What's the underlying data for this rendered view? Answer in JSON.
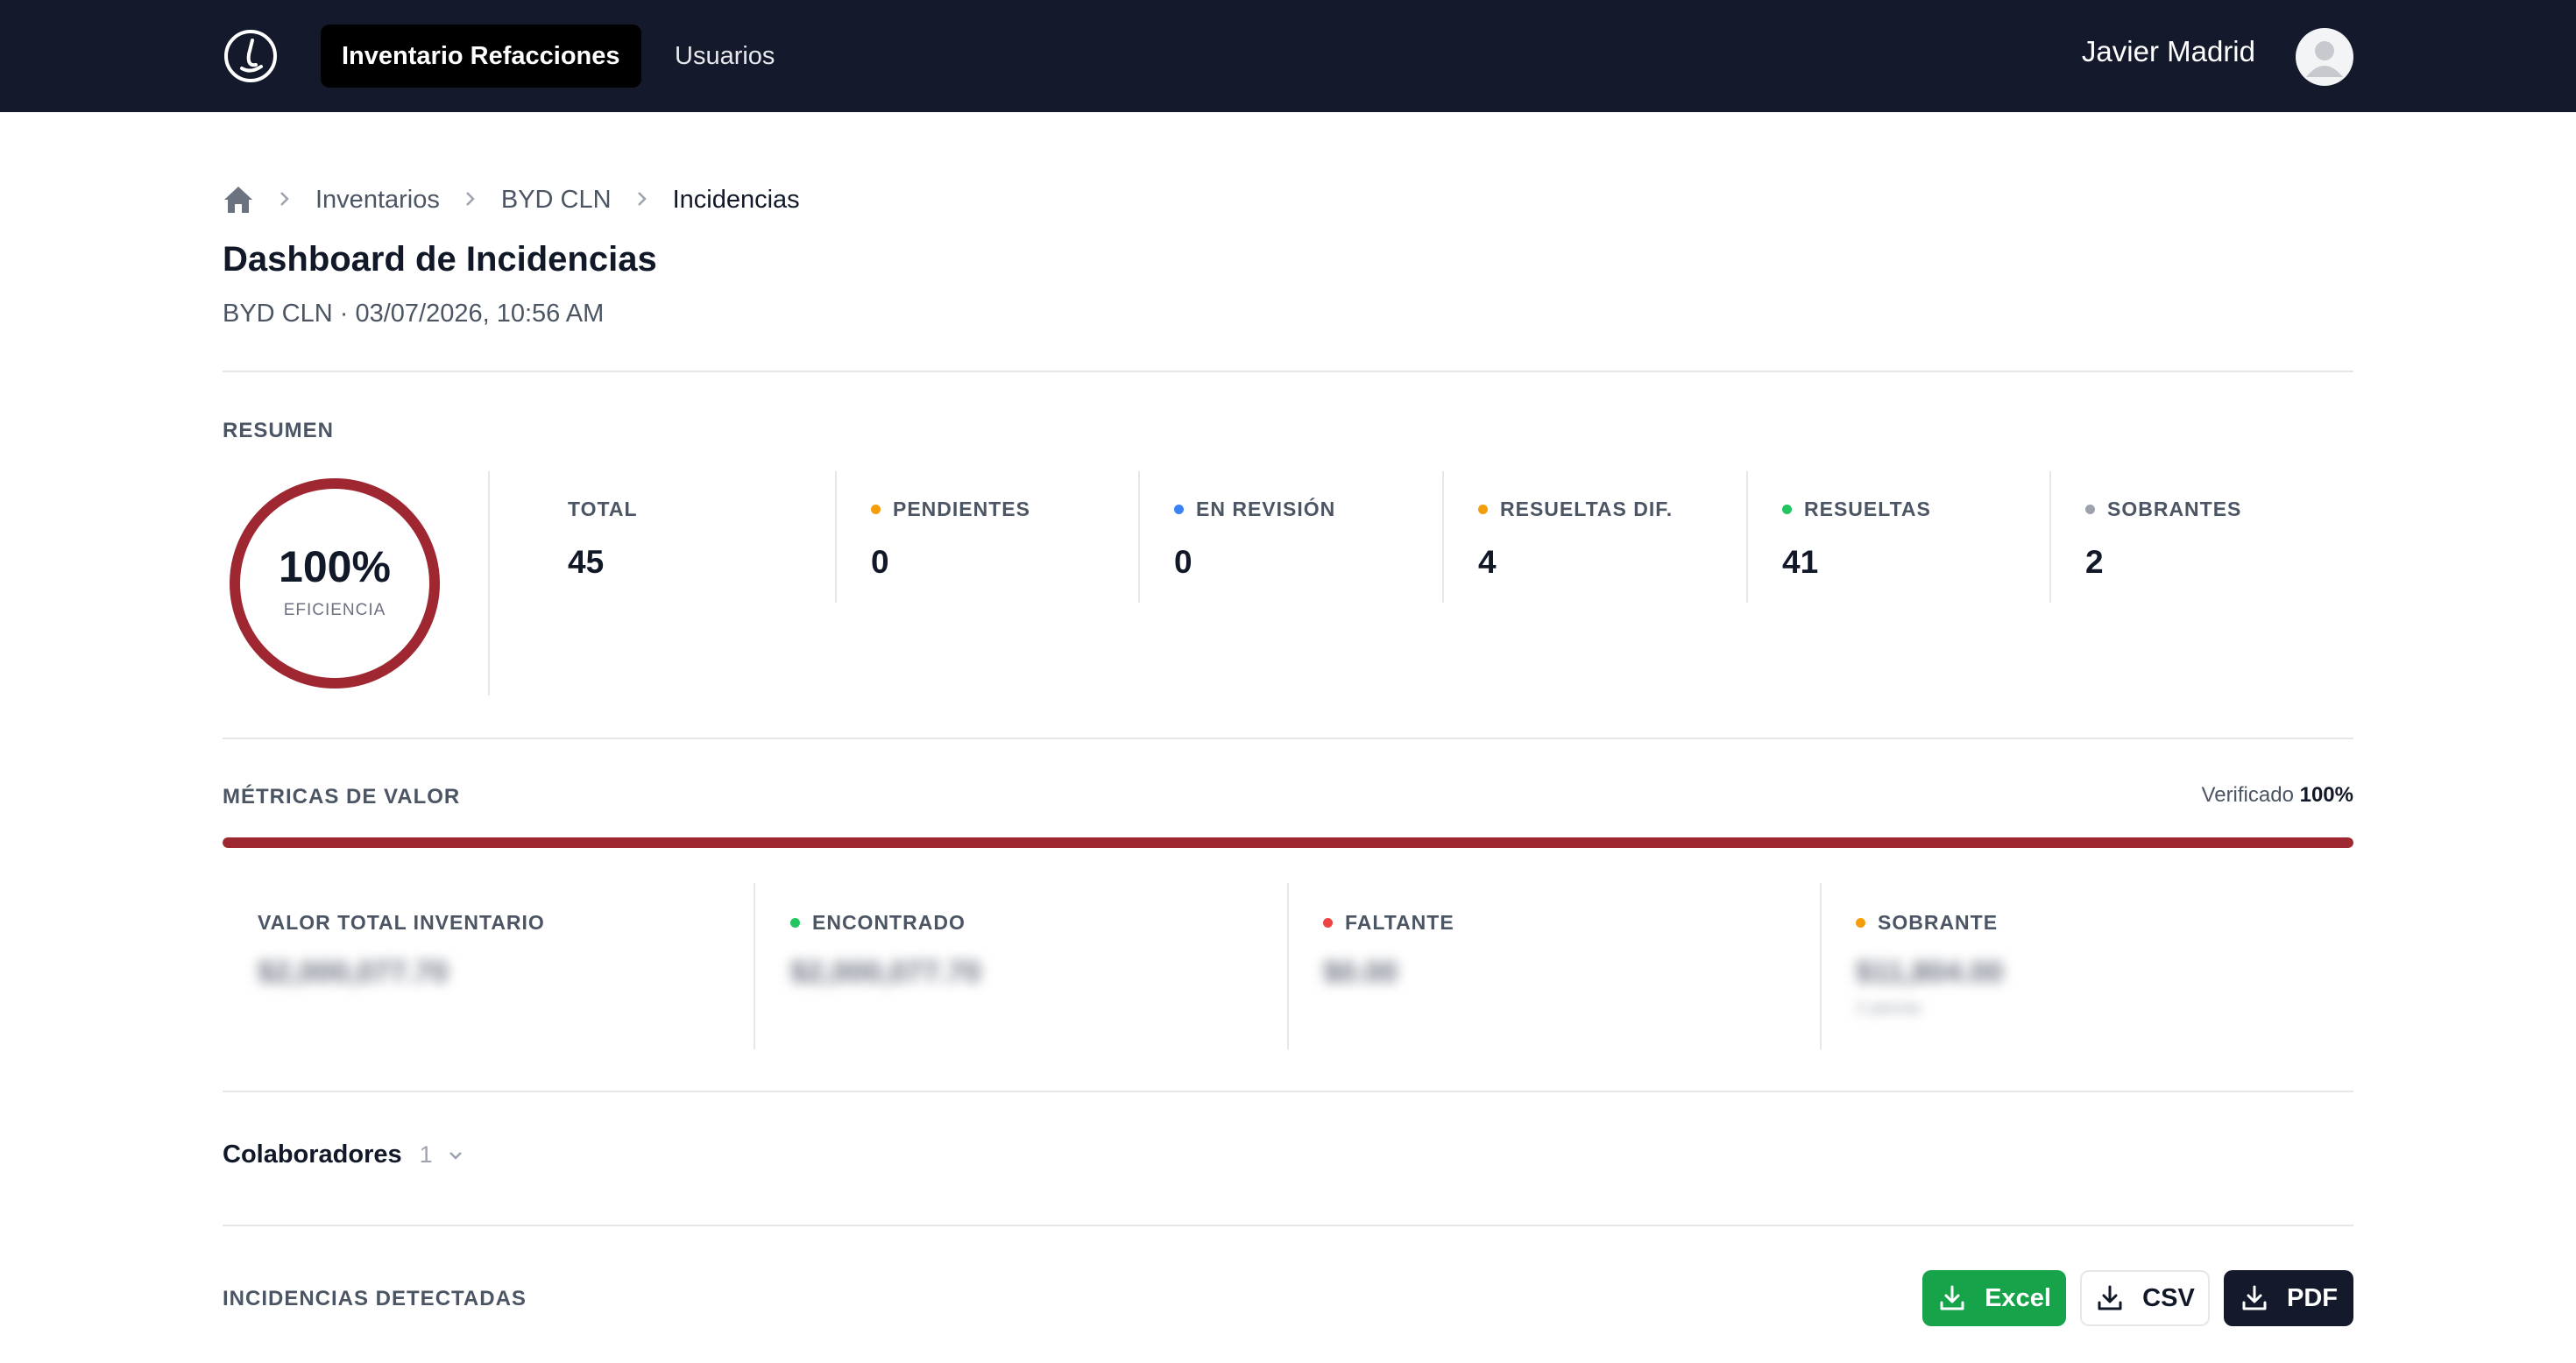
{
  "nav": {
    "tabs": [
      {
        "label": "Inventario Refacciones",
        "active": true
      },
      {
        "label": "Usuarios",
        "active": false
      }
    ],
    "user_name": "Javier Madrid",
    "logo_icon": "clock-logo-icon",
    "avatar_icon": "user-avatar-icon"
  },
  "breadcrumb": {
    "home_icon": "home-icon",
    "items": [
      "Inventarios",
      "BYD CLN",
      "Incidencias"
    ]
  },
  "page": {
    "title": "Dashboard de Incidencias",
    "subtitle": "BYD CLN · 03/07/2026, 10:56 AM"
  },
  "resumen": {
    "label": "RESUMEN",
    "efficiency": {
      "value": "100%",
      "label": "EFICIENCIA",
      "fraction": 1.0
    },
    "stats": [
      {
        "label": "TOTAL",
        "value": "45",
        "dot_color": null
      },
      {
        "label": "PENDIENTES",
        "value": "0",
        "dot_color": "#f59e0b"
      },
      {
        "label": "EN REVISIÓN",
        "value": "0",
        "dot_color": "#3b82f6"
      },
      {
        "label": "RESUELTAS DIF.",
        "value": "4",
        "dot_color": "#f59e0b"
      },
      {
        "label": "RESUELTAS",
        "value": "41",
        "dot_color": "#22c55e"
      },
      {
        "label": "SOBRANTES",
        "value": "2",
        "dot_color": "#9ca3af"
      }
    ]
  },
  "metricas": {
    "label": "MÉTRICAS DE VALOR",
    "verified_label": "Verificado",
    "verified_value": "100%",
    "verified_fraction": 1.0,
    "bar_color": "#9f2731",
    "items": [
      {
        "label": "VALOR TOTAL INVENTARIO",
        "value": "$2,000,077.70",
        "dot_color": null
      },
      {
        "label": "ENCONTRADO",
        "value": "$2,000,077.70",
        "dot_color": "#22c55e"
      },
      {
        "label": "FALTANTE",
        "value": "$0.00",
        "dot_color": "#ef4444"
      },
      {
        "label": "SOBRANTE",
        "value": "$11,804.00",
        "dot_color": "#f59e0b",
        "extra": "2 piezas"
      }
    ]
  },
  "colaboradores": {
    "label": "Colaboradores",
    "count": "1",
    "chevron_icon": "chevron-down-icon"
  },
  "incidencias": {
    "label": "INCIDENCIAS DETECTADAS",
    "buttons": [
      {
        "label": "Excel",
        "icon": "download-icon",
        "color": "#16a34a"
      },
      {
        "label": "CSV",
        "icon": "download-icon"
      },
      {
        "label": "PDF",
        "icon": "download-icon",
        "color": "#141a2b"
      }
    ]
  },
  "colors": {
    "navbar": "#141a2b",
    "accent": "#9f2731"
  }
}
